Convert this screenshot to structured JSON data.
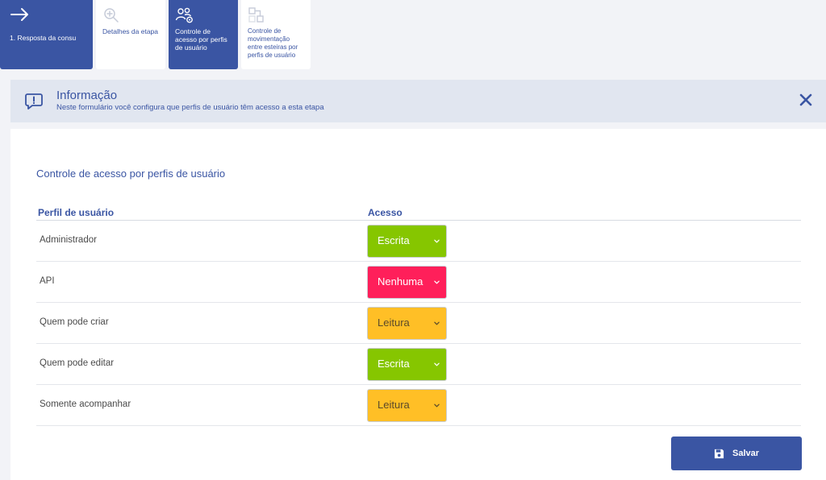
{
  "steps": [
    {
      "label": "1. Resposta da consu",
      "icon": "arrow-right-icon",
      "active": true
    },
    {
      "label": "Detalhes da etapa",
      "icon": "zoom-in-icon",
      "active": false
    },
    {
      "label": "Controle de acesso por perfis de usuário",
      "icon": "users-gear-icon",
      "active": true
    },
    {
      "label": "Controle de movimentação entre esteiras por perfis de usuário",
      "icon": "flow-icon",
      "active": false
    }
  ],
  "info": {
    "title": "Informação",
    "description": "Neste formulário você configura que perfis de usuário têm acesso a esta etapa"
  },
  "main": {
    "section_title": "Controle de acesso por perfis de usuário",
    "columns": [
      "Perfil de usuário",
      "Acesso"
    ],
    "rows": [
      {
        "profile": "Administrador",
        "access": "Escrita",
        "color": "#86c600",
        "text_color": "#ffffff"
      },
      {
        "profile": "API",
        "access": "Nenhuma",
        "color": "#ff1f5a",
        "text_color": "#ffffff"
      },
      {
        "profile": "Quem pode criar",
        "access": "Leitura",
        "color": "#ffbf26",
        "text_color": "#5a4a2a"
      },
      {
        "profile": "Quem pode editar",
        "access": "Escrita",
        "color": "#86c600",
        "text_color": "#ffffff"
      },
      {
        "profile": "Somente acompanhar",
        "access": "Leitura",
        "color": "#ffbf26",
        "text_color": "#5a4a2a"
      }
    ],
    "save_label": "Salvar"
  },
  "colors": {
    "primary": "#3a55a3",
    "banner_bg": "#e1e6f0"
  }
}
